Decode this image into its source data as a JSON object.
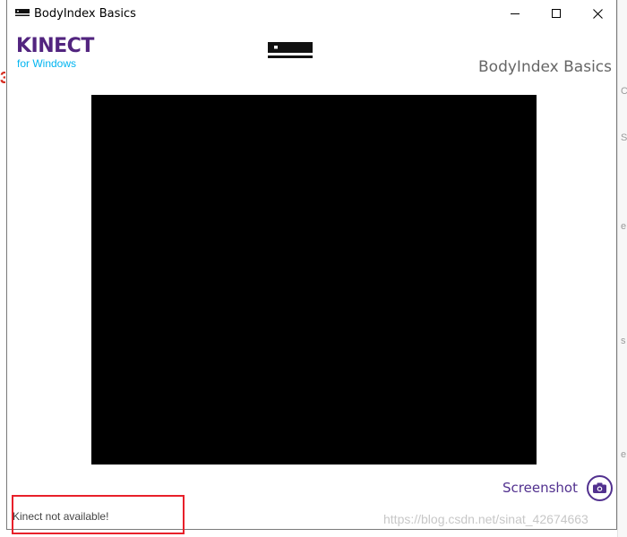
{
  "window": {
    "title": "BodyIndex Basics",
    "controls": [
      "minimize",
      "maximize",
      "close"
    ]
  },
  "logo": {
    "main": "KINECT",
    "sub": "for Windows"
  },
  "header": {
    "app_title": "BodyIndex Basics"
  },
  "actions": {
    "screenshot_label": "Screenshot"
  },
  "status": {
    "text": "Kinect not available!"
  },
  "watermark": "https://blog.csdn.net/sinat_42674663",
  "colors": {
    "kinect_purple": "#52247f",
    "kinect_blue": "#00b4f0",
    "highlight_red": "#e8202a"
  },
  "icons": [
    "sensor-icon",
    "camera-icon",
    "app-icon"
  ]
}
